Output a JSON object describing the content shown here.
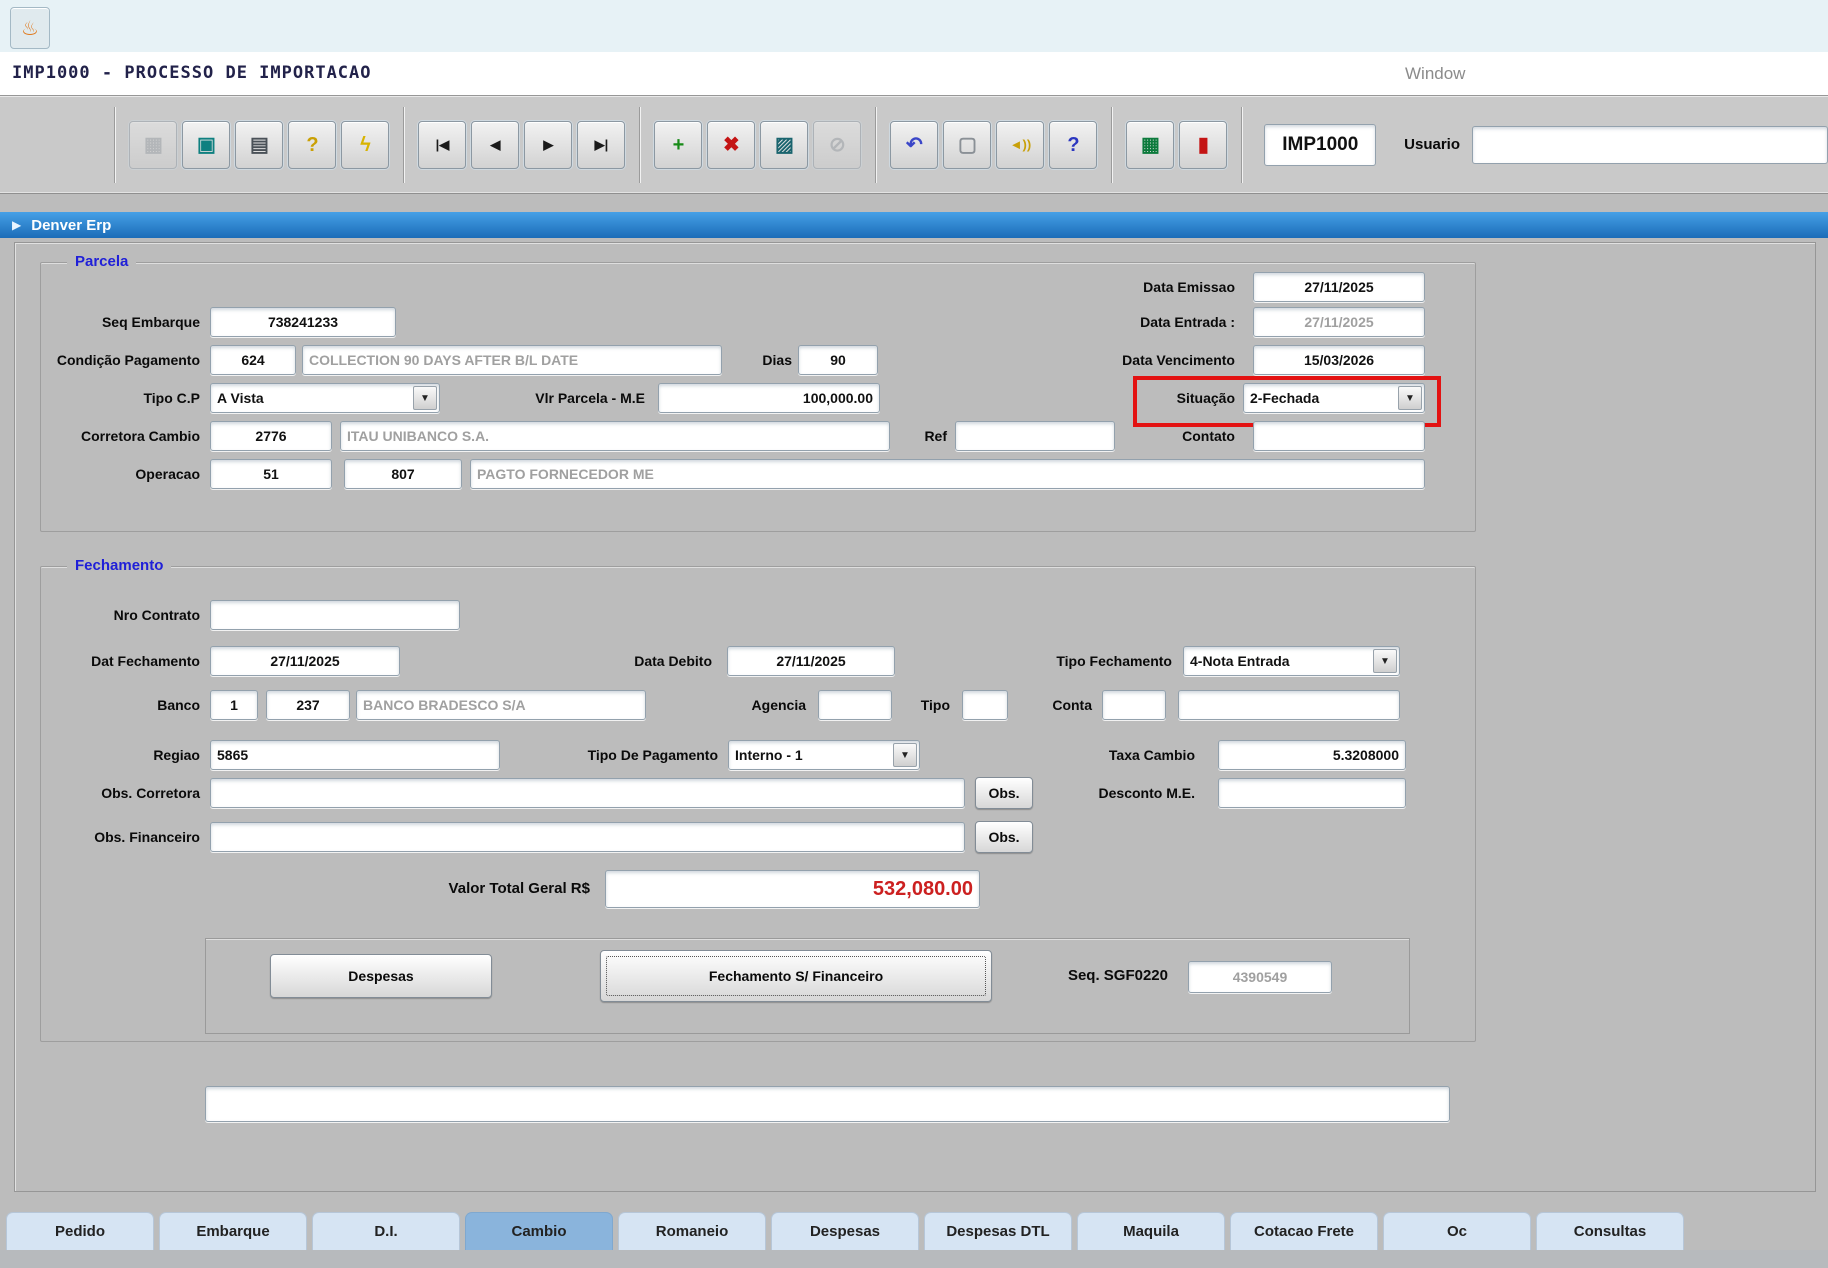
{
  "app": {
    "launcher_icon": "app-launcher-icon",
    "title": "IMP1000 - PROCESSO DE IMPORTACAO",
    "window_menu": "Window",
    "program_code": "IMP1000",
    "usuario_label": "Usuario",
    "usuario_value": "",
    "window_title": "Denver Erp"
  },
  "toolbar": {
    "groups": [
      [
        {
          "name": "save-icon",
          "glyph": "▦",
          "color": "#9aa0a6",
          "disabled": true
        },
        {
          "name": "screen-icon",
          "glyph": "▣",
          "color": "#0f8080",
          "disabled": false
        },
        {
          "name": "print-icon",
          "glyph": "▤",
          "color": "#4a5158",
          "disabled": false
        },
        {
          "name": "help-locate-icon",
          "glyph": "?",
          "color": "#caa004",
          "disabled": false
        },
        {
          "name": "lightning-icon",
          "glyph": "ϟ",
          "color": "#d8b300",
          "disabled": false
        }
      ],
      [
        {
          "name": "first-record-icon",
          "glyph": "|◀",
          "color": "#1a1a1a",
          "disabled": false,
          "small": true
        },
        {
          "name": "prev-record-icon",
          "glyph": "◀",
          "color": "#1a1a1a",
          "disabled": false,
          "small": true
        },
        {
          "name": "next-record-icon",
          "glyph": "▶",
          "color": "#1a1a1a",
          "disabled": false,
          "small": true
        },
        {
          "name": "last-record-icon",
          "glyph": "▶|",
          "color": "#1a1a1a",
          "disabled": false,
          "small": true
        }
      ],
      [
        {
          "name": "add-record-icon",
          "glyph": "+",
          "color": "#178a17",
          "disabled": false
        },
        {
          "name": "delete-record-icon",
          "glyph": "✖",
          "color": "#c41414",
          "disabled": false
        },
        {
          "name": "edit-window-icon",
          "glyph": "▨",
          "color": "#19646e",
          "disabled": false
        },
        {
          "name": "clear-icon",
          "glyph": "⊘",
          "color": "#9aa0a6",
          "disabled": true
        }
      ],
      [
        {
          "name": "undo-icon",
          "glyph": "↶",
          "color": "#3a46c8",
          "disabled": false
        },
        {
          "name": "paste-icon",
          "glyph": "▢",
          "color": "#8a9096",
          "disabled": false
        },
        {
          "name": "alert-icon",
          "glyph": "◄))",
          "color": "#c8a00a",
          "disabled": false,
          "small": true
        },
        {
          "name": "help-icon",
          "glyph": "?",
          "color": "#2b36c0",
          "disabled": false
        }
      ],
      [
        {
          "name": "report-menu-icon",
          "glyph": "▦",
          "color": "#0c7a3c",
          "disabled": false
        },
        {
          "name": "exit-icon",
          "glyph": "▮",
          "color": "#c41414",
          "disabled": false
        }
      ]
    ]
  },
  "parcela": {
    "section_title": "Parcela",
    "data_emissao": {
      "label": "Data Emissao",
      "value": "27/11/2025"
    },
    "seq_embarque": {
      "label": "Seq Embarque",
      "value": "738241233"
    },
    "data_entrada": {
      "label": "Data Entrada :",
      "value": "27/11/2025"
    },
    "condicao_pagamento": {
      "label": "Condição Pagamento",
      "code": "624",
      "desc": "COLLECTION 90 DAYS AFTER B/L DATE"
    },
    "dias": {
      "label": "Dias",
      "value": "90"
    },
    "data_vencimento": {
      "label": "Data Vencimento",
      "value": "15/03/2026"
    },
    "tipo_cp": {
      "label": "Tipo C.P",
      "value": "A Vista"
    },
    "vlr_parcela": {
      "label": "Vlr Parcela - M.E",
      "value": "100,000.00"
    },
    "situacao": {
      "label": "Situação",
      "value": "2-Fechada"
    },
    "corretora_cambio": {
      "label": "Corretora Cambio",
      "code": "2776",
      "desc": "ITAU UNIBANCO S.A."
    },
    "ref": {
      "label": "Ref",
      "value": ""
    },
    "contato": {
      "label": "Contato",
      "value": ""
    },
    "operacao": {
      "label": "Operacao",
      "code1": "51",
      "code2": "807",
      "desc": "PAGTO FORNECEDOR ME"
    }
  },
  "fechamento": {
    "section_title": "Fechamento",
    "nro_contrato": {
      "label": "Nro Contrato",
      "value": ""
    },
    "dat_fechamento": {
      "label": "Dat Fechamento",
      "value": "27/11/2025"
    },
    "data_debito": {
      "label": "Data Debito",
      "value": "27/11/2025"
    },
    "tipo_fechamento": {
      "label": "Tipo Fechamento",
      "value": "4-Nota Entrada"
    },
    "banco": {
      "label": "Banco",
      "code1": "1",
      "code2": "237",
      "desc": "BANCO BRADESCO S/A"
    },
    "agencia": {
      "label": "Agencia",
      "value": ""
    },
    "tipo": {
      "label": "Tipo",
      "value": ""
    },
    "conta": {
      "label": "Conta",
      "value1": "",
      "value2": ""
    },
    "regiao": {
      "label": "Regiao",
      "value": "5865"
    },
    "tipo_pagamento": {
      "label": "Tipo De Pagamento",
      "value": "Interno - 1"
    },
    "taxa_cambio": {
      "label": "Taxa Cambio",
      "value": "5.3208000"
    },
    "obs_corretora": {
      "label": "Obs. Corretora",
      "value": "",
      "button": "Obs."
    },
    "desconto_me": {
      "label": "Desconto M.E.",
      "value": ""
    },
    "obs_financeiro": {
      "label": "Obs. Financeiro",
      "value": "",
      "button": "Obs."
    },
    "valor_total": {
      "label": "Valor Total Geral R$",
      "value": "532,080.00"
    },
    "despesas_button": "Despesas",
    "fechamento_financeiro_button": "Fechamento S/ Financeiro",
    "seq_sgf": {
      "label": "Seq. SGF0220",
      "value": "4390549"
    },
    "footer_field": ""
  },
  "tabs": [
    {
      "label": "Pedido",
      "active": false
    },
    {
      "label": "Embarque",
      "active": false
    },
    {
      "label": "D.I.",
      "active": false
    },
    {
      "label": "Cambio",
      "active": true
    },
    {
      "label": "Romaneio",
      "active": false
    },
    {
      "label": "Despesas",
      "active": false
    },
    {
      "label": "Despesas DTL",
      "active": false
    },
    {
      "label": "Maquila",
      "active": false
    },
    {
      "label": "Cotacao Frete",
      "active": false
    },
    {
      "label": "Oc",
      "active": false
    },
    {
      "label": "Consultas",
      "active": false
    }
  ],
  "colors": {
    "titlebar_blue": "#1b6cb8",
    "section_label_blue": "#2020d8",
    "highlight_red": "#e31212",
    "total_value_red": "#cc2020",
    "active_tab_blue": "#8ab4dc"
  }
}
